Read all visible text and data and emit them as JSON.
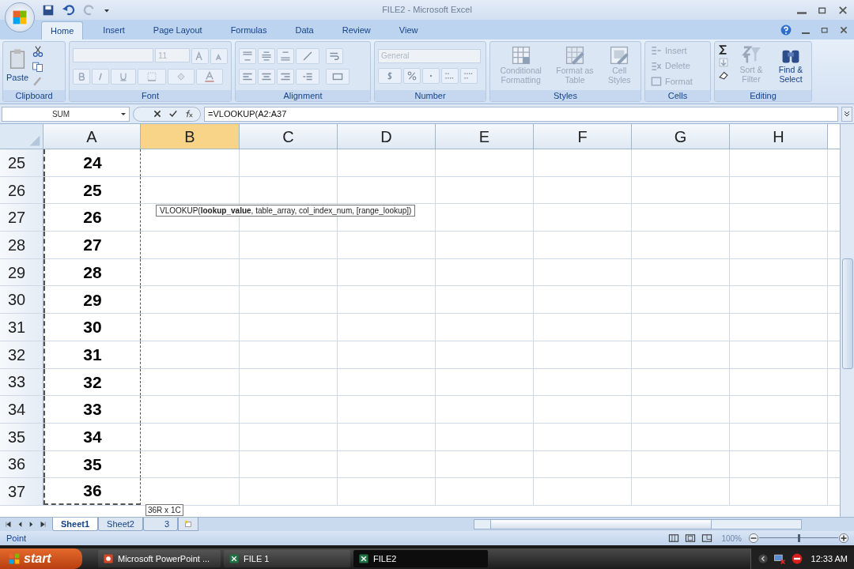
{
  "window": {
    "title": "FILE2 - Microsoft Excel"
  },
  "ribbon_tabs": [
    {
      "label": "Home",
      "selected": true
    },
    {
      "label": "Insert",
      "selected": false
    },
    {
      "label": "Page Layout",
      "selected": false
    },
    {
      "label": "Formulas",
      "selected": false
    },
    {
      "label": "Data",
      "selected": false
    },
    {
      "label": "Review",
      "selected": false
    },
    {
      "label": "View",
      "selected": false
    }
  ],
  "ribbon_groups": [
    {
      "kind": "clipboard",
      "label": "Clipboard",
      "buttons": [
        {
          "label": "Paste",
          "disabled": false
        }
      ]
    },
    {
      "kind": "font",
      "label": "Font",
      "font_size": "11"
    },
    {
      "kind": "alignment",
      "label": "Alignment"
    },
    {
      "kind": "number",
      "label": "Number",
      "format": "General"
    },
    {
      "kind": "large",
      "label": "Styles",
      "buttons": [
        {
          "label": "Conditional Formatting",
          "disabled": true
        },
        {
          "label": "Format as Table",
          "disabled": true
        },
        {
          "label": "Cell Styles",
          "disabled": true
        }
      ]
    },
    {
      "kind": "small",
      "label": "Cells",
      "buttons": [
        {
          "label": "Insert",
          "disabled": true
        },
        {
          "label": "Delete",
          "disabled": true
        },
        {
          "label": "Format",
          "disabled": true
        }
      ]
    },
    {
      "kind": "editing",
      "label": "Editing",
      "buttons": [
        {
          "label": "Sort & Filter",
          "disabled": true
        },
        {
          "label": "Find & Select",
          "disabled": false
        }
      ]
    }
  ],
  "formula_bar": {
    "name_box": "SUM",
    "formula": "=VLOOKUP(A2:A37"
  },
  "columns": [
    {
      "label": "A",
      "selected": false
    },
    {
      "label": "B",
      "selected": true
    },
    {
      "label": "C",
      "selected": false
    },
    {
      "label": "D",
      "selected": false
    },
    {
      "label": "E",
      "selected": false
    },
    {
      "label": "F",
      "selected": false
    },
    {
      "label": "G",
      "selected": false
    },
    {
      "label": "H",
      "selected": false
    }
  ],
  "rows": [
    {
      "number": "25",
      "a": "24"
    },
    {
      "number": "26",
      "a": "25"
    },
    {
      "number": "27",
      "a": "26"
    },
    {
      "number": "28",
      "a": "27"
    },
    {
      "number": "29",
      "a": "28"
    },
    {
      "number": "30",
      "a": "29"
    },
    {
      "number": "31",
      "a": "30"
    },
    {
      "number": "32",
      "a": "31"
    },
    {
      "number": "33",
      "a": "32"
    },
    {
      "number": "34",
      "a": "33"
    },
    {
      "number": "35",
      "a": "34"
    },
    {
      "number": "36",
      "a": "35"
    },
    {
      "number": "37",
      "a": "36"
    }
  ],
  "function_tooltip": "VLOOKUP(**lookup_value**, table_array, col_index_num, [range_lookup])",
  "sheet_tabs": [
    {
      "label": "Sheet1",
      "selected": true
    },
    {
      "label": "Sheet2",
      "selected": false
    },
    {
      "label": "3",
      "selected": false
    }
  ],
  "range_tooltip": "36R x 1C",
  "status_bar": {
    "mode": "Point",
    "zoom": "100%",
    "zoom_slider": {
      "level": 0.5
    }
  },
  "taskbar": {
    "start": "start",
    "tasks": [
      {
        "label": "Microsoft PowerPoint ...",
        "selected": false
      },
      {
        "label": "FILE 1",
        "selected": false
      },
      {
        "label": "FILE2",
        "selected": true
      }
    ],
    "clock": "12:33 AM"
  }
}
